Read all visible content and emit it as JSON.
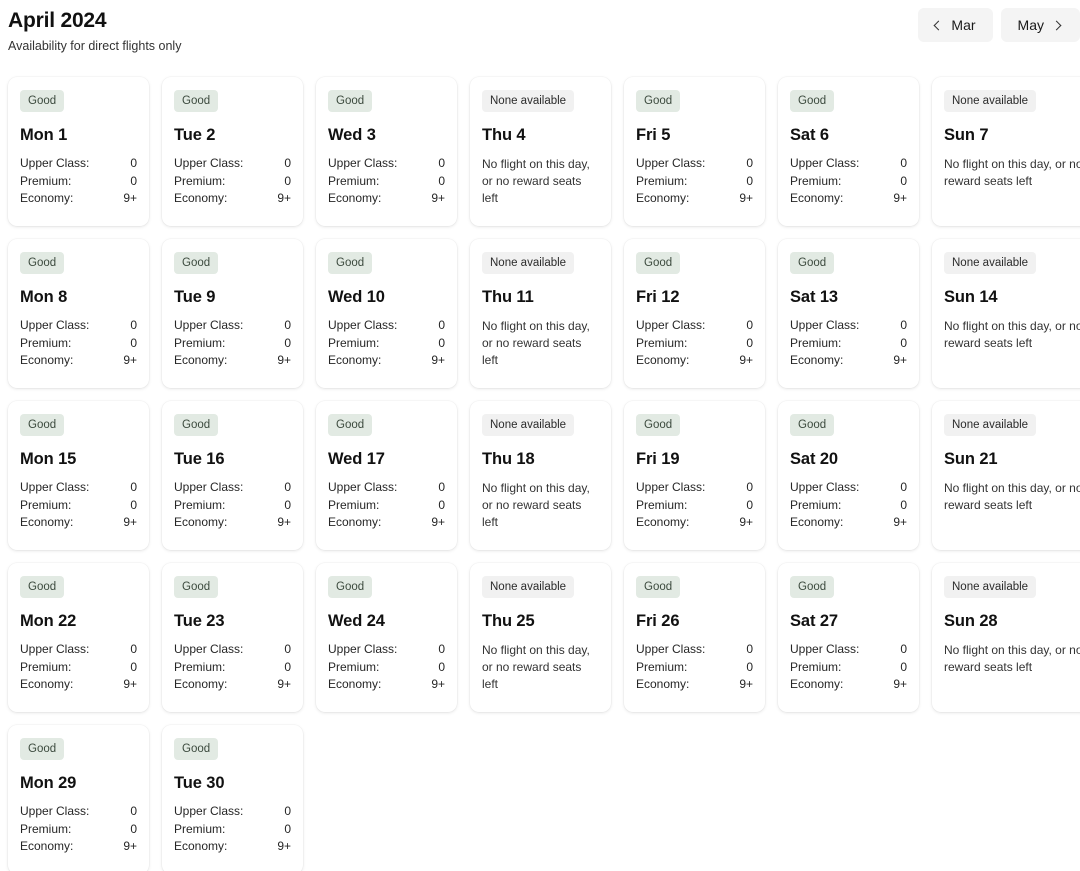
{
  "header": {
    "title": "April 2024",
    "subtitle": "Availability for direct flights only",
    "prev_label": "Mar",
    "next_label": "May",
    "prev_icon": "chevron-left-icon",
    "next_icon": "chevron-right-icon"
  },
  "labels": {
    "badge_good": "Good",
    "badge_none": "None available",
    "cabin_upper": "Upper Class:",
    "cabin_premium": "Premium:",
    "cabin_economy": "Economy:",
    "no_flight_text": "No flight on this day, or no reward seats left"
  },
  "colors": {
    "badge_good_bg": "#e2eae3",
    "badge_good_text": "#3c4a3e",
    "badge_none_bg": "#f1f1f1",
    "badge_none_text": "#2b2b2b",
    "nav_button_bg": "#f4f4f4",
    "card_bg": "#ffffff",
    "page_bg": "#ffffff"
  },
  "weeks": [
    [
      {
        "day": "Mon 1",
        "status": "good",
        "badge": "Good",
        "upper": "0",
        "premium": "0",
        "economy": "9+"
      },
      {
        "day": "Tue 2",
        "status": "good",
        "badge": "Good",
        "upper": "0",
        "premium": "0",
        "economy": "9+"
      },
      {
        "day": "Wed 3",
        "status": "good",
        "badge": "Good",
        "upper": "0",
        "premium": "0",
        "economy": "9+"
      },
      {
        "day": "Thu 4",
        "status": "none",
        "badge": "None available",
        "message": "No flight on this day, or no reward seats left"
      },
      {
        "day": "Fri 5",
        "status": "good",
        "badge": "Good",
        "upper": "0",
        "premium": "0",
        "economy": "9+"
      },
      {
        "day": "Sat 6",
        "status": "good",
        "badge": "Good",
        "upper": "0",
        "premium": "0",
        "economy": "9+"
      },
      {
        "day": "Sun 7",
        "status": "none",
        "badge": "None available",
        "message": "No flight on this day, or no reward seats left"
      }
    ],
    [
      {
        "day": "Mon 8",
        "status": "good",
        "badge": "Good",
        "upper": "0",
        "premium": "0",
        "economy": "9+"
      },
      {
        "day": "Tue 9",
        "status": "good",
        "badge": "Good",
        "upper": "0",
        "premium": "0",
        "economy": "9+"
      },
      {
        "day": "Wed 10",
        "status": "good",
        "badge": "Good",
        "upper": "0",
        "premium": "0",
        "economy": "9+"
      },
      {
        "day": "Thu 11",
        "status": "none",
        "badge": "None available",
        "message": "No flight on this day, or no reward seats left"
      },
      {
        "day": "Fri 12",
        "status": "good",
        "badge": "Good",
        "upper": "0",
        "premium": "0",
        "economy": "9+"
      },
      {
        "day": "Sat 13",
        "status": "good",
        "badge": "Good",
        "upper": "0",
        "premium": "0",
        "economy": "9+"
      },
      {
        "day": "Sun 14",
        "status": "none",
        "badge": "None available",
        "message": "No flight on this day, or no reward seats left"
      }
    ],
    [
      {
        "day": "Mon 15",
        "status": "good",
        "badge": "Good",
        "upper": "0",
        "premium": "0",
        "economy": "9+"
      },
      {
        "day": "Tue 16",
        "status": "good",
        "badge": "Good",
        "upper": "0",
        "premium": "0",
        "economy": "9+"
      },
      {
        "day": "Wed 17",
        "status": "good",
        "badge": "Good",
        "upper": "0",
        "premium": "0",
        "economy": "9+"
      },
      {
        "day": "Thu 18",
        "status": "none",
        "badge": "None available",
        "message": "No flight on this day, or no reward seats left"
      },
      {
        "day": "Fri 19",
        "status": "good",
        "badge": "Good",
        "upper": "0",
        "premium": "0",
        "economy": "9+"
      },
      {
        "day": "Sat 20",
        "status": "good",
        "badge": "Good",
        "upper": "0",
        "premium": "0",
        "economy": "9+"
      },
      {
        "day": "Sun 21",
        "status": "none",
        "badge": "None available",
        "message": "No flight on this day, or no reward seats left"
      }
    ],
    [
      {
        "day": "Mon 22",
        "status": "good",
        "badge": "Good",
        "upper": "0",
        "premium": "0",
        "economy": "9+"
      },
      {
        "day": "Tue 23",
        "status": "good",
        "badge": "Good",
        "upper": "0",
        "premium": "0",
        "economy": "9+"
      },
      {
        "day": "Wed 24",
        "status": "good",
        "badge": "Good",
        "upper": "0",
        "premium": "0",
        "economy": "9+"
      },
      {
        "day": "Thu 25",
        "status": "none",
        "badge": "None available",
        "message": "No flight on this day, or no reward seats left"
      },
      {
        "day": "Fri 26",
        "status": "good",
        "badge": "Good",
        "upper": "0",
        "premium": "0",
        "economy": "9+"
      },
      {
        "day": "Sat 27",
        "status": "good",
        "badge": "Good",
        "upper": "0",
        "premium": "0",
        "economy": "9+"
      },
      {
        "day": "Sun 28",
        "status": "none",
        "badge": "None available",
        "message": "No flight on this day, or no reward seats left"
      }
    ],
    [
      {
        "day": "Mon 29",
        "status": "good",
        "badge": "Good",
        "upper": "0",
        "premium": "0",
        "economy": "9+"
      },
      {
        "day": "Tue 30",
        "status": "good",
        "badge": "Good",
        "upper": "0",
        "premium": "0",
        "economy": "9+"
      }
    ]
  ]
}
